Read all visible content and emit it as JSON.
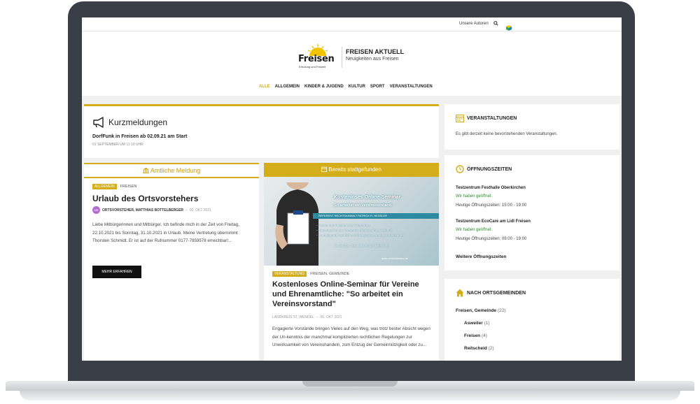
{
  "topbar": {
    "about_link": "Unsere Autoren",
    "search_icon": "search-icon"
  },
  "brand": {
    "logo_word": "Freisen",
    "logo_sub": "Erholung und Freizeit",
    "title": "FREISEN AKTUELL",
    "subtitle": "Neuigkeiten aus Freisen"
  },
  "nav": {
    "items": [
      "ALLE",
      "ALLGEMEIN",
      "KINDER & JUGEND",
      "KULTUR",
      "SPORT",
      "VERANSTALTUNGEN"
    ],
    "active_index": 0
  },
  "kurzmeldungen": {
    "title": "Kurzmeldungen",
    "headline": "DorfFunk in Freisen ab 02.09.21 am Start",
    "date": "01 SEPTEMBER UM 11:19 UHR"
  },
  "amtlich": {
    "header": "Amtliche Meldung",
    "tag": "ALLGEMEIN",
    "category": "FREISEN",
    "title": "Urlaub des Ortsvorstehers",
    "avatar_initials": "MB",
    "author": "ORTSVORSTEHER, MATTHIAS BOTTELBERGER",
    "date": "02. OKT 2021",
    "excerpt": "Liebe Mitbürgerinnen und Mitbürger. Ich befinde mich in der Zeit von Freitag, 22.10.2021 bis Sonntag, 31.10.2021 in Urlaub. Meine Vertretung übernimmt Thorsten Schmidt. Er ist auf der Rufnummer 0177-7959578 erreichbar!...",
    "more_label": "MEHR ERFAHREN"
  },
  "bereits": {
    "header": "Bereits stattgefunden",
    "banner_title": "Kostenloses Online-Seminar",
    "banner_sub": "So arbeitet ein Vereinsvorstand",
    "banner_ref": "REFERENT RECHTSANWALT PATRICK R. NESSLER",
    "banner_bullets": [
      "- Rechte und Pflichten des Vorstandes",
      "- Was muss bei der Vorstandsarbeit beachtet werden?",
      "- Grundlegende rechtliche Anforderungen an eine Vereinsarbeit"
    ],
    "banner_date": "13. Oktober 2021 | 17:00 bis 19:00 Uhr",
    "banner_web": "www.vereinsbuero.de",
    "tag": "VERANSTALTUNG",
    "category": "FREISEN, GEMEINDE",
    "title": "Kostenloses Online-Seminar für Vereine und Ehrenamtliche: \"So arbeitet ein Vereinsvorstand\"",
    "author": "LANDKREIS ST. WENDEL",
    "date": "06. OKT 2021",
    "excerpt": "Engagierte Vorstände bringen Vieles auf den Weg, was trotz bester Absicht wegen der Un-kenntnis der manchmal komplizierten rechtlichen Regelungen zur Unwirksamkeit von Vereinshandeln, zum Entzug der Gemeinnützigkeit oder zu..."
  },
  "sidebar": {
    "events": {
      "title": "VERANSTALTUNGEN",
      "text": "Es gibt derzeit keine bevorstehenden Veranstaltungen."
    },
    "hours": {
      "title": "ÖFFNUNGSZEITEN",
      "places": [
        {
          "name": "Testzentrum Festhalle Oberkirchen",
          "status": "Wir haben geöffnet.",
          "today": "Heutige Öffnungszeiten: 15:00 - 19:00"
        },
        {
          "name": "Testzentrum EcoCare am Lidl Freisen",
          "status": "Wir haben geöffnet.",
          "today": "Heutige Öffnungszeiten: 09:00 - 19:00"
        }
      ],
      "more_link": "Weitere Öffnungszeiten"
    },
    "towns": {
      "title": "NACH ORTSGEMEINDEN",
      "root": "Freisen, Gemeinde",
      "root_count": "(22)",
      "items": [
        {
          "name": "Asweiler",
          "count": "(1)"
        },
        {
          "name": "Freisen",
          "count": "(4)"
        },
        {
          "name": "Reitscheid",
          "count": "(2)"
        }
      ]
    }
  },
  "colors": {
    "accent": "#d4ad1b",
    "open_green": "#2e8b32"
  }
}
